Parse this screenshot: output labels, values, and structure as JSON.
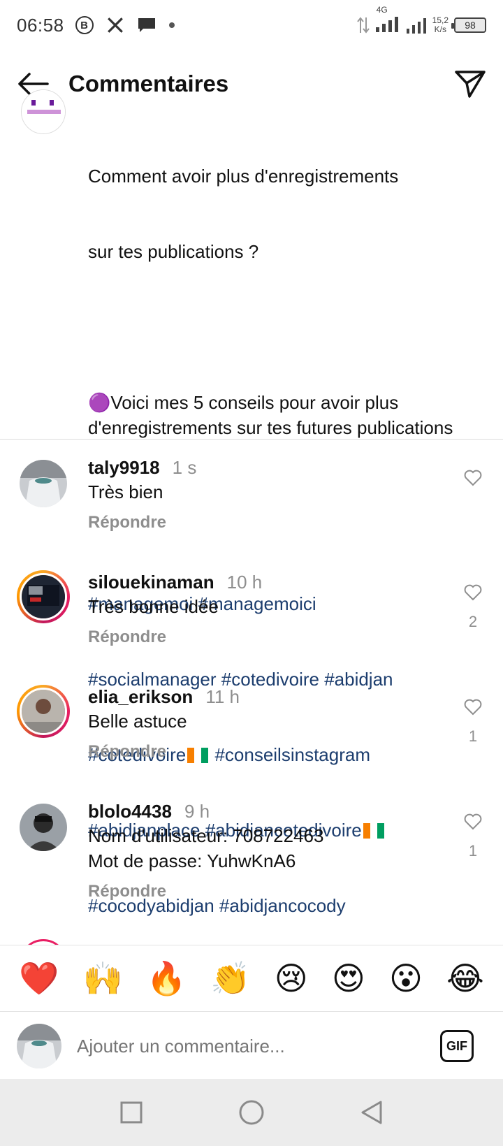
{
  "status_bar": {
    "time": "06:58",
    "network": "4G",
    "speed_value": "15,2",
    "speed_unit": "K/s",
    "battery": "98"
  },
  "header": {
    "title": "Commentaires"
  },
  "caption": {
    "line1": "Comment avoir plus d'enregistrements",
    "line2": "sur tes publications ?",
    "tips_emoji": "🟣",
    "tips_text": "Voici mes 5 conseils pour avoir plus d'enregistrements sur tes futures publications",
    "hashtags_1": "#managemoi #managemoici",
    "hashtags_2": "#socialmanager #cotedivoire #abidjan",
    "hashtags_3a": "#cotedivoire",
    "hashtags_3b": "#conseilsinstagram",
    "hashtags_4": "#abidjanplace #abidjancotedivoire",
    "hashtags_5": "#cocodyabidjan #abidjancocody"
  },
  "comments": [
    {
      "username": "taly9918",
      "time": "1 s",
      "lines": [
        "Très bien"
      ],
      "reply": "Répondre",
      "likes": ""
    },
    {
      "username": "silouekinaman",
      "time": "10 h",
      "lines": [
        "Très bonne idée"
      ],
      "reply": "Répondre",
      "likes": "2"
    },
    {
      "username": "elia_erikson",
      "time": "11 h",
      "lines": [
        "Belle astuce"
      ],
      "reply": "Répondre",
      "likes": "1"
    },
    {
      "username": "blolo4438",
      "time": "9 h",
      "lines": [
        "Nom d'utilisateur: 708722463",
        "Mot de passe: YuhwKnA6"
      ],
      "reply": "Répondre",
      "likes": "1"
    }
  ],
  "emoji_bar": [
    "❤️",
    "🙌",
    "🔥",
    "👏",
    "😢",
    "😍",
    "😮",
    "😂"
  ],
  "composer": {
    "placeholder": "Ajouter un commentaire...",
    "gif_label": "GIF"
  },
  "colors": {
    "hashtag": "#1c3d6e",
    "muted": "#8e8e8e",
    "story_ring": "#e91e63"
  }
}
